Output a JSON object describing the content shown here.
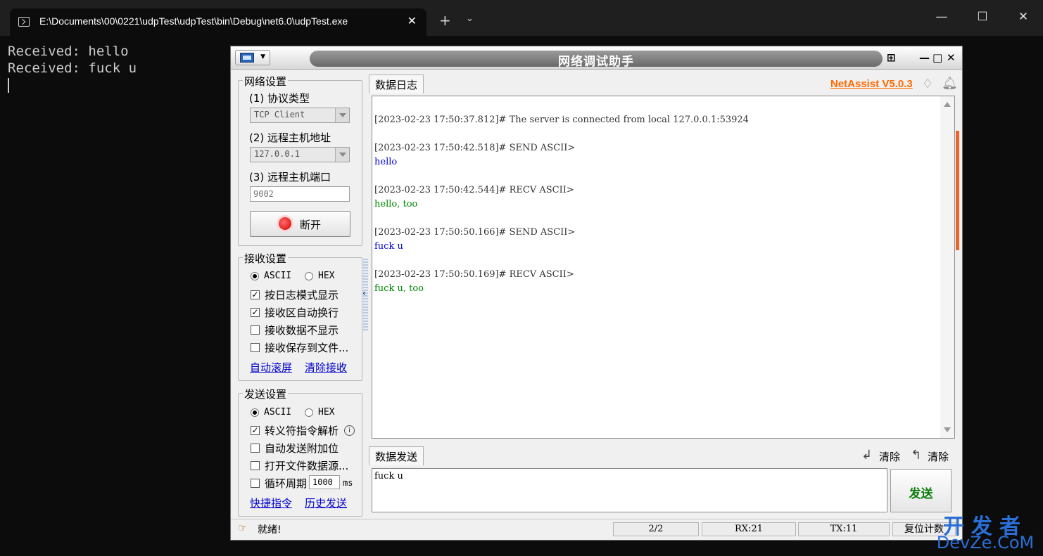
{
  "terminal": {
    "tab_title": "E:\\Documents\\00\\0221\\udpTest\\udpTest\\bin\\Debug\\net6.0\\udpTest.exe",
    "close_glyph": "✕",
    "newtab_glyph": "+",
    "dropdown_glyph": "⌄",
    "minimize_glyph": "—",
    "maximize_glyph": "☐",
    "window_close_glyph": "✕",
    "lines": [
      "Received: hello",
      "Received: fuck u"
    ]
  },
  "netassist": {
    "title": "网络调试助手",
    "title_buttons": {
      "pin": "⊞",
      "minimize": "—",
      "maximize": "□",
      "close": "✕"
    },
    "network_settings": {
      "legend": "网络设置",
      "protocol_label": "(1) 协议类型",
      "protocol_value": "TCP Client",
      "host_label": "(2) 远程主机地址",
      "host_value": "127.0.0.1",
      "port_label": "(3) 远程主机端口",
      "port_value": "9002",
      "disconnect_label": "断开"
    },
    "receive_settings": {
      "legend": "接收设置",
      "ascii_label": "ASCII",
      "hex_label": "HEX",
      "options": [
        {
          "label": "按日志模式显示",
          "checked": true
        },
        {
          "label": "接收区自动换行",
          "checked": true
        },
        {
          "label": "接收数据不显示",
          "checked": false
        },
        {
          "label": "接收保存到文件...",
          "checked": false
        }
      ],
      "link_autoscroll": "自动滚屏",
      "link_clear": "清除接收"
    },
    "send_settings": {
      "legend": "发送设置",
      "ascii_label": "ASCII",
      "hex_label": "HEX",
      "options": [
        {
          "label": "转义符指令解析",
          "checked": true
        },
        {
          "label": "自动发送附加位",
          "checked": false
        },
        {
          "label": "打开文件数据源...",
          "checked": false
        },
        {
          "label": "循环周期",
          "checked": false
        }
      ],
      "cycle_value": "1000",
      "cycle_unit": "ms",
      "link_shortcut": "快捷指令",
      "link_history": "历史发送"
    },
    "log_tab": "数据日志",
    "version": "NetAssist V5.0.3",
    "log_lines": [
      {
        "text": "[2023-02-23 17:50:37.812]# The server is connected from local 127.0.0.1:53924",
        "kind": "meta"
      },
      {
        "text": "[2023-02-23 17:50:42.518]# SEND ASCII>",
        "kind": "meta"
      },
      {
        "text": "hello",
        "kind": "send"
      },
      {
        "text": "[2023-02-23 17:50:42.544]# RECV ASCII>",
        "kind": "meta"
      },
      {
        "text": "hello, too",
        "kind": "recv"
      },
      {
        "text": "[2023-02-23 17:50:50.166]# SEND ASCII>",
        "kind": "meta"
      },
      {
        "text": "fuck u",
        "kind": "send"
      },
      {
        "text": "[2023-02-23 17:50:50.169]# RECV ASCII>",
        "kind": "meta"
      },
      {
        "text": "fuck u, too",
        "kind": "recv"
      }
    ],
    "send_tab": "数据发送",
    "clear_label_1": "清除",
    "clear_label_2": "清除",
    "send_text": "fuck u",
    "send_button": "发送",
    "status": {
      "ready": "就绪!",
      "count": "2/2",
      "rx": "RX:21",
      "tx": "TX:11",
      "reset": "复位计数"
    }
  },
  "watermark": {
    "top": "开发者",
    "bottom": "DevZe.CoM"
  },
  "colors": {
    "send": "#0000dd",
    "recv": "#008800",
    "version": "#ff6a00",
    "scroll_accent": "#e9662c"
  }
}
